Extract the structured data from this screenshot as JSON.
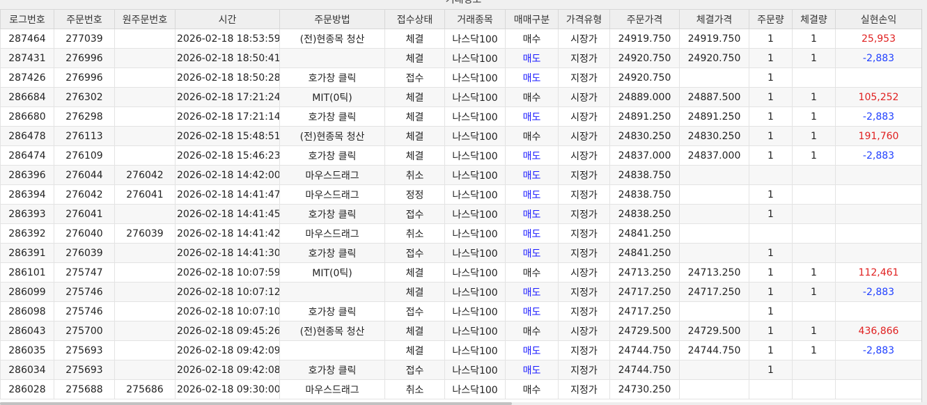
{
  "window": {
    "title": "거래정보"
  },
  "columns": [
    "로그번호",
    "주문번호",
    "원주문번호",
    "시간",
    "주문방법",
    "접수상태",
    "거래종목",
    "매매구분",
    "가격유형",
    "주문가격",
    "체결가격",
    "주문량",
    "체결량",
    "실현손익"
  ],
  "rows": [
    {
      "log": "287464",
      "order": "277039",
      "orig": "",
      "time": "2026-02-18 18:53:59",
      "method": "(전)현종목 청산",
      "status": "체결",
      "symbol": "나스닥100",
      "side": "매수",
      "ptype": "시장가",
      "oprice": "24919.750",
      "fprice": "24919.750",
      "oqty": "1",
      "fqty": "1",
      "pnl": "25,953",
      "pnl_sign": "profit"
    },
    {
      "log": "287431",
      "order": "276996",
      "orig": "",
      "time": "2026-02-18 18:50:41",
      "method": "",
      "status": "체결",
      "symbol": "나스닥100",
      "side": "매도",
      "ptype": "지정가",
      "oprice": "24920.750",
      "fprice": "24920.750",
      "oqty": "1",
      "fqty": "1",
      "pnl": "-2,883",
      "pnl_sign": "loss"
    },
    {
      "log": "287426",
      "order": "276996",
      "orig": "",
      "time": "2026-02-18 18:50:28",
      "method": "호가창 클릭",
      "status": "접수",
      "symbol": "나스닥100",
      "side": "매도",
      "ptype": "지정가",
      "oprice": "24920.750",
      "fprice": "",
      "oqty": "1",
      "fqty": "",
      "pnl": "",
      "pnl_sign": ""
    },
    {
      "log": "286684",
      "order": "276302",
      "orig": "",
      "time": "2026-02-18 17:21:24",
      "method": "MIT(0틱)",
      "status": "체결",
      "symbol": "나스닥100",
      "side": "매수",
      "ptype": "시장가",
      "oprice": "24889.000",
      "fprice": "24887.500",
      "oqty": "1",
      "fqty": "1",
      "pnl": "105,252",
      "pnl_sign": "profit"
    },
    {
      "log": "286680",
      "order": "276298",
      "orig": "",
      "time": "2026-02-18 17:21:14",
      "method": "호가창 클릭",
      "status": "체결",
      "symbol": "나스닥100",
      "side": "매도",
      "ptype": "시장가",
      "oprice": "24891.250",
      "fprice": "24891.250",
      "oqty": "1",
      "fqty": "1",
      "pnl": "-2,883",
      "pnl_sign": "loss"
    },
    {
      "log": "286478",
      "order": "276113",
      "orig": "",
      "time": "2026-02-18 15:48:51",
      "method": "(전)현종목 청산",
      "status": "체결",
      "symbol": "나스닥100",
      "side": "매수",
      "ptype": "시장가",
      "oprice": "24830.250",
      "fprice": "24830.250",
      "oqty": "1",
      "fqty": "1",
      "pnl": "191,760",
      "pnl_sign": "profit"
    },
    {
      "log": "286474",
      "order": "276109",
      "orig": "",
      "time": "2026-02-18 15:46:23",
      "method": "호가창 클릭",
      "status": "체결",
      "symbol": "나스닥100",
      "side": "매도",
      "ptype": "시장가",
      "oprice": "24837.000",
      "fprice": "24837.000",
      "oqty": "1",
      "fqty": "1",
      "pnl": "-2,883",
      "pnl_sign": "loss"
    },
    {
      "log": "286396",
      "order": "276044",
      "orig": "276042",
      "time": "2026-02-18 14:42:00",
      "method": "마우스드래그",
      "status": "취소",
      "symbol": "나스닥100",
      "side": "매도",
      "ptype": "지정가",
      "oprice": "24838.750",
      "fprice": "",
      "oqty": "",
      "fqty": "",
      "pnl": "",
      "pnl_sign": ""
    },
    {
      "log": "286394",
      "order": "276042",
      "orig": "276041",
      "time": "2026-02-18 14:41:47",
      "method": "마우스드래그",
      "status": "정정",
      "symbol": "나스닥100",
      "side": "매도",
      "ptype": "지정가",
      "oprice": "24838.750",
      "fprice": "",
      "oqty": "1",
      "fqty": "",
      "pnl": "",
      "pnl_sign": ""
    },
    {
      "log": "286393",
      "order": "276041",
      "orig": "",
      "time": "2026-02-18 14:41:45",
      "method": "호가창 클릭",
      "status": "접수",
      "symbol": "나스닥100",
      "side": "매도",
      "ptype": "지정가",
      "oprice": "24838.250",
      "fprice": "",
      "oqty": "1",
      "fqty": "",
      "pnl": "",
      "pnl_sign": ""
    },
    {
      "log": "286392",
      "order": "276040",
      "orig": "276039",
      "time": "2026-02-18 14:41:42",
      "method": "마우스드래그",
      "status": "취소",
      "symbol": "나스닥100",
      "side": "매도",
      "ptype": "지정가",
      "oprice": "24841.250",
      "fprice": "",
      "oqty": "",
      "fqty": "",
      "pnl": "",
      "pnl_sign": ""
    },
    {
      "log": "286391",
      "order": "276039",
      "orig": "",
      "time": "2026-02-18 14:41:30",
      "method": "호가창 클릭",
      "status": "접수",
      "symbol": "나스닥100",
      "side": "매도",
      "ptype": "지정가",
      "oprice": "24841.250",
      "fprice": "",
      "oqty": "1",
      "fqty": "",
      "pnl": "",
      "pnl_sign": ""
    },
    {
      "log": "286101",
      "order": "275747",
      "orig": "",
      "time": "2026-02-18 10:07:59",
      "method": "MIT(0틱)",
      "status": "체결",
      "symbol": "나스닥100",
      "side": "매수",
      "ptype": "시장가",
      "oprice": "24713.250",
      "fprice": "24713.250",
      "oqty": "1",
      "fqty": "1",
      "pnl": "112,461",
      "pnl_sign": "profit"
    },
    {
      "log": "286099",
      "order": "275746",
      "orig": "",
      "time": "2026-02-18 10:07:12",
      "method": "",
      "status": "체결",
      "symbol": "나스닥100",
      "side": "매도",
      "ptype": "지정가",
      "oprice": "24717.250",
      "fprice": "24717.250",
      "oqty": "1",
      "fqty": "1",
      "pnl": "-2,883",
      "pnl_sign": "loss"
    },
    {
      "log": "286098",
      "order": "275746",
      "orig": "",
      "time": "2026-02-18 10:07:10",
      "method": "호가창 클릭",
      "status": "접수",
      "symbol": "나스닥100",
      "side": "매도",
      "ptype": "지정가",
      "oprice": "24717.250",
      "fprice": "",
      "oqty": "1",
      "fqty": "",
      "pnl": "",
      "pnl_sign": ""
    },
    {
      "log": "286043",
      "order": "275700",
      "orig": "",
      "time": "2026-02-18 09:45:26",
      "method": "(전)현종목 청산",
      "status": "체결",
      "symbol": "나스닥100",
      "side": "매수",
      "ptype": "시장가",
      "oprice": "24729.500",
      "fprice": "24729.500",
      "oqty": "1",
      "fqty": "1",
      "pnl": "436,866",
      "pnl_sign": "profit"
    },
    {
      "log": "286035",
      "order": "275693",
      "orig": "",
      "time": "2026-02-18 09:42:09",
      "method": "",
      "status": "체결",
      "symbol": "나스닥100",
      "side": "매도",
      "ptype": "지정가",
      "oprice": "24744.750",
      "fprice": "24744.750",
      "oqty": "1",
      "fqty": "1",
      "pnl": "-2,883",
      "pnl_sign": "loss"
    },
    {
      "log": "286034",
      "order": "275693",
      "orig": "",
      "time": "2026-02-18 09:42:08",
      "method": "호가창 클릭",
      "status": "접수",
      "symbol": "나스닥100",
      "side": "매도",
      "ptype": "지정가",
      "oprice": "24744.750",
      "fprice": "",
      "oqty": "1",
      "fqty": "",
      "pnl": "",
      "pnl_sign": ""
    },
    {
      "log": "286028",
      "order": "275688",
      "orig": "275686",
      "time": "2026-02-18 09:30:00",
      "method": "마우스드래그",
      "status": "취소",
      "symbol": "나스닥100",
      "side": "매수",
      "ptype": "지정가",
      "oprice": "24730.250",
      "fprice": "",
      "oqty": "",
      "fqty": "",
      "pnl": "",
      "pnl_sign": ""
    }
  ],
  "colors": {
    "sell": "#1a1aff",
    "profit": "#e02020",
    "loss": "#2040ff"
  }
}
